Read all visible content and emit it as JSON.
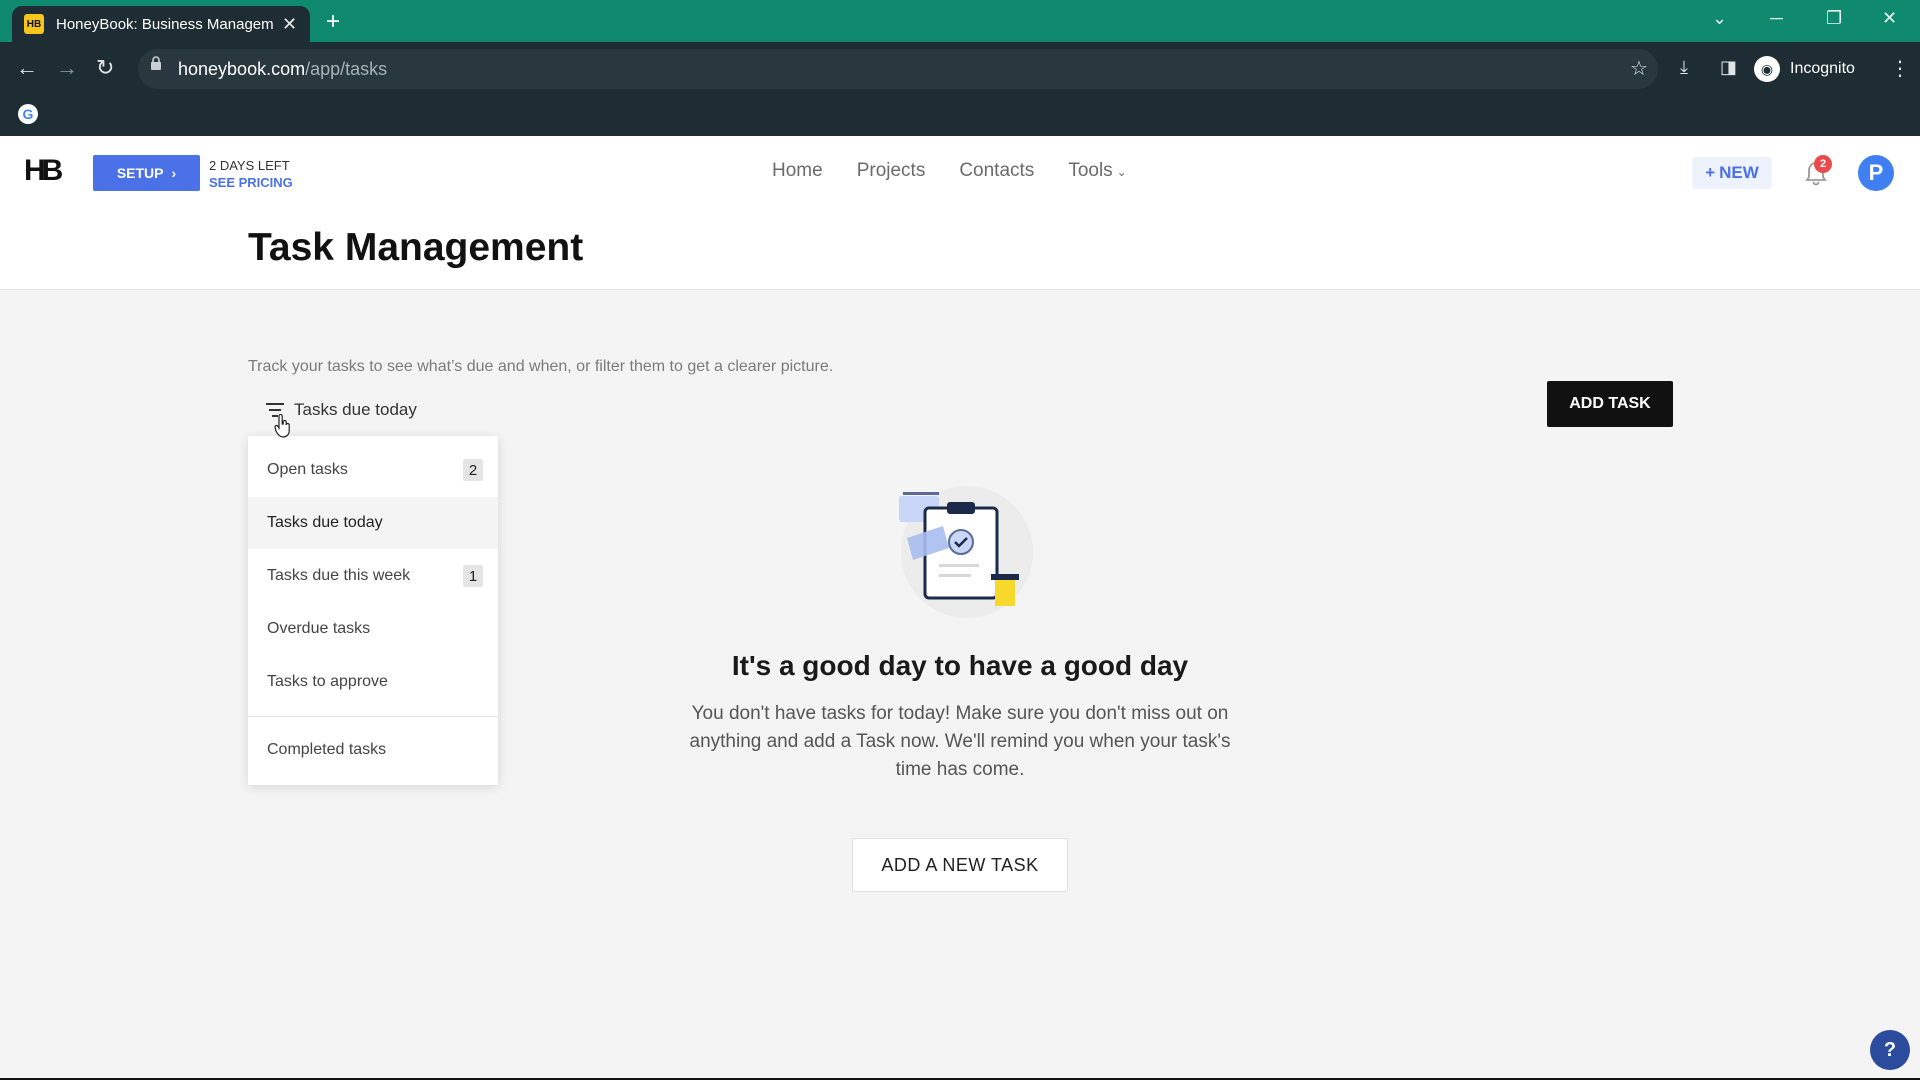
{
  "browser": {
    "tab_title": "HoneyBook: Business Management",
    "tab_favicon": "HB",
    "url_domain": "honeybook.com",
    "url_path": "/app/tasks",
    "incognito_label": "Incognito"
  },
  "header": {
    "logo": "HB",
    "setup_label": "SETUP",
    "days_left": "2 DAYS LEFT",
    "see_pricing": "SEE PRICING",
    "nav": {
      "home": "Home",
      "projects": "Projects",
      "contacts": "Contacts",
      "tools": "Tools"
    },
    "new_label": "NEW",
    "notification_count": "2",
    "avatar_initial": "P"
  },
  "page": {
    "title": "Task Management",
    "subtitle": "Track your tasks to see what’s due and when, or filter them to get a clearer picture.",
    "filter_label": "Tasks due today",
    "add_task_label": "ADD TASK"
  },
  "filter_menu": {
    "items": [
      {
        "label": "Open tasks",
        "count": "2"
      },
      {
        "label": "Tasks due today",
        "count": ""
      },
      {
        "label": "Tasks due this week",
        "count": "1"
      },
      {
        "label": "Overdue tasks",
        "count": ""
      },
      {
        "label": "Tasks to approve",
        "count": ""
      },
      {
        "label": "Completed tasks",
        "count": ""
      }
    ]
  },
  "empty_state": {
    "title": "It's a good day to have a good day",
    "body": "You don't have tasks for today! Make sure you don't miss out on anything and add a Task now. We'll remind you when your task's time has come.",
    "button_label": "ADD A NEW TASK"
  },
  "help_label": "?"
}
